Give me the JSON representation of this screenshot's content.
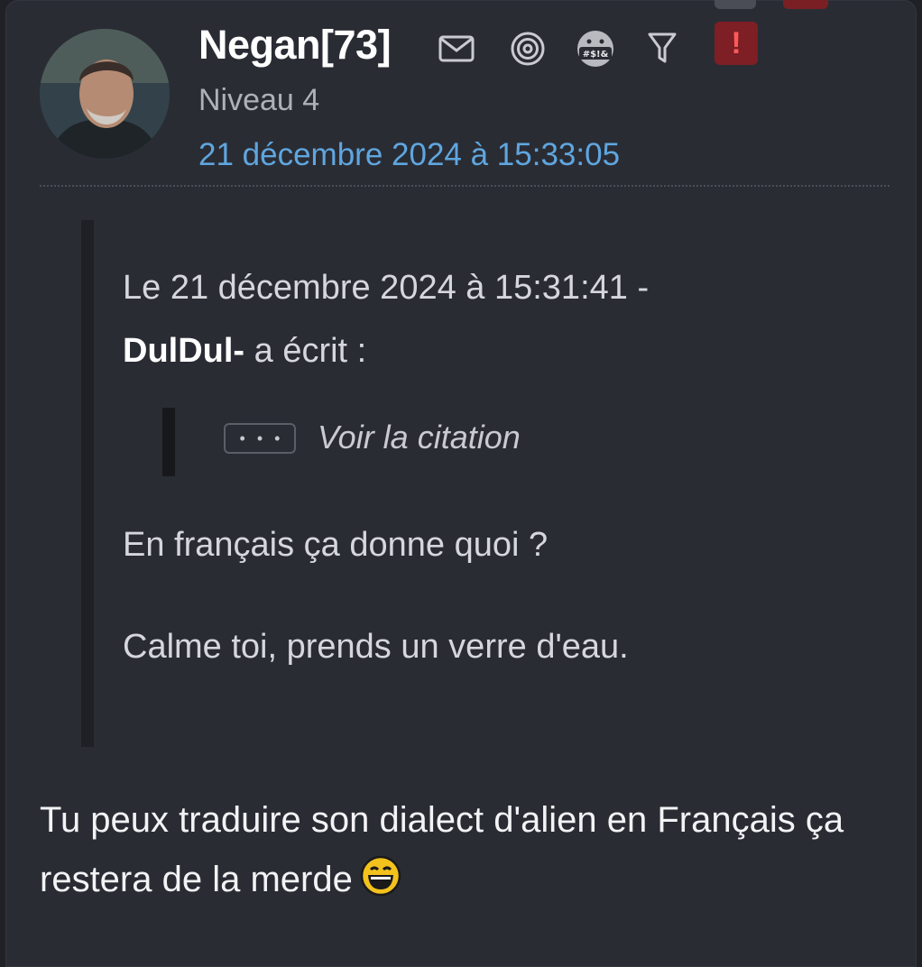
{
  "post": {
    "username": "Negan[73]",
    "level": "Niveau 4",
    "date": "21 décembre 2024 à 15:33:05",
    "icons": [
      "mail-icon",
      "spiral-icon",
      "censor-icon",
      "filter-icon",
      "alert-icon"
    ],
    "alert_label": "!",
    "censor_text": "#$!&"
  },
  "quote": {
    "header_prefix": "Le 21 décembre 2024 à 15:31:41 -",
    "author": "DulDul-",
    "header_suffix": " a écrit :",
    "expand_label": "• • •",
    "view_label": "Voir la citation",
    "line1": "En français ça donne quoi ?",
    "line2": "Calme toi, prends un verre d'eau."
  },
  "message": {
    "text": "Tu peux traduire son dialect d'alien en Français ça restera de la merde",
    "emoji": "laughing-smiley"
  },
  "colors": {
    "background": "#2a2c34",
    "link": "#5fa6df",
    "alert_bg": "#7d1f24",
    "alert_fg": "#ff5a5a"
  }
}
